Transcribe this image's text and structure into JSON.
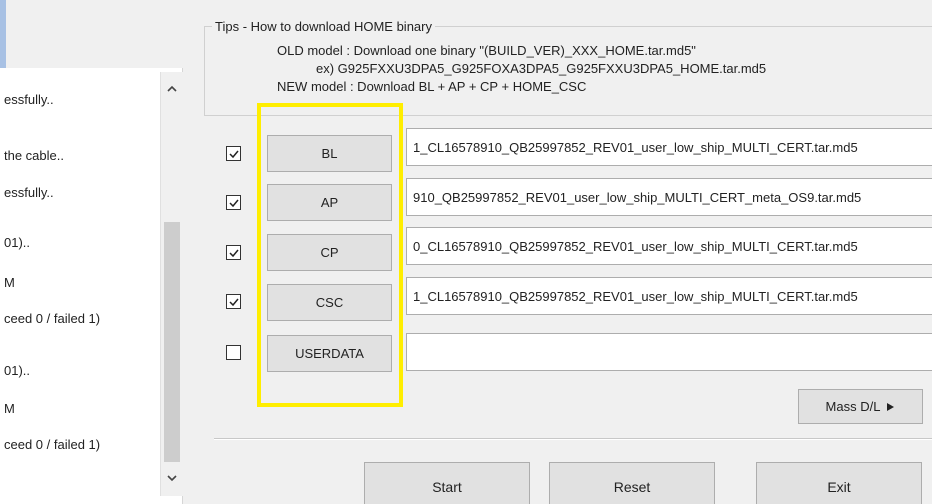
{
  "log": {
    "lines": [
      "essfully..",
      "the cable..",
      "essfully..",
      "01)..",
      "M",
      "ceed 0 / failed 1)",
      "01)..",
      "M",
      "ceed 0 / failed 1)"
    ]
  },
  "tips": {
    "title": "Tips - How to download HOME binary",
    "old_model": "OLD model : Download one binary   \"(BUILD_VER)_XXX_HOME.tar.md5\"",
    "example": "ex) G925FXXU3DPA5_G925FOXA3DPA5_G925FXXU3DPA5_HOME.tar.md5",
    "new_model": "NEW model : Download BL + AP + CP + HOME_CSC"
  },
  "rows": [
    {
      "label": "BL",
      "checked": true,
      "path": "1_CL16578910_QB25997852_REV01_user_low_ship_MULTI_CERT.tar.md5"
    },
    {
      "label": "AP",
      "checked": true,
      "path": "910_QB25997852_REV01_user_low_ship_MULTI_CERT_meta_OS9.tar.md5"
    },
    {
      "label": "CP",
      "checked": true,
      "path": "0_CL16578910_QB25997852_REV01_user_low_ship_MULTI_CERT.tar.md5"
    },
    {
      "label": "CSC",
      "checked": true,
      "path": "1_CL16578910_QB25997852_REV01_user_low_ship_MULTI_CERT.tar.md5"
    },
    {
      "label": "USERDATA",
      "checked": false,
      "path": ""
    }
  ],
  "mass_dl": {
    "label": "Mass D/L",
    "icon": "play-triangle-icon"
  },
  "actions": {
    "start": "Start",
    "reset": "Reset",
    "exit": "Exit"
  },
  "colors": {
    "highlight": "#ffee00"
  }
}
